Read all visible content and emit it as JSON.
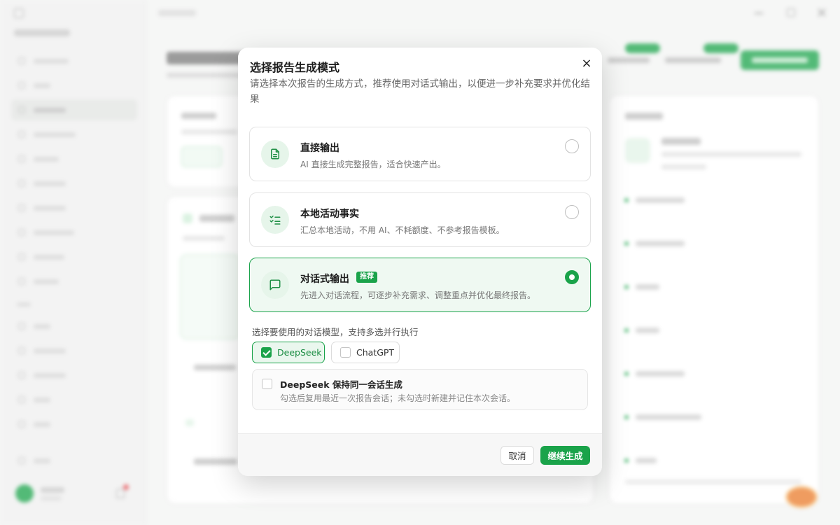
{
  "modal": {
    "title": "选择报告生成模式",
    "description": "请选择本次报告的生成方式，推荐使用对话式输出，以便进一步补充要求并优化结果",
    "close_icon": "×",
    "options": [
      {
        "title": "直接输出",
        "desc": "AI 直接生成完整报告，适合快速产出。",
        "icon": "document-icon",
        "selected": false
      },
      {
        "title": "本地活动事实",
        "desc": "汇总本地活动，不用 AI、不耗额度、不参考报告模板。",
        "icon": "checklist-icon",
        "selected": false
      },
      {
        "title": "对话式输出",
        "badge": "推荐",
        "desc": "先进入对话流程，可逐步补充需求、调整重点并优化最终报告。",
        "icon": "chat-bubble-icon",
        "selected": true
      }
    ],
    "model_label": "选择要使用的对话模型，支持多选并行执行",
    "models": [
      {
        "label": "DeepSeek",
        "checked": true
      },
      {
        "label": "ChatGPT",
        "checked": false
      }
    ],
    "keep_session": {
      "title": "DeepSeek 保持同一会话生成",
      "desc": "勾选后复用最近一次报告会话；未勾选时新建并记住本次会话。",
      "checked": false
    },
    "cancel_label": "取消",
    "continue_label": "继续生成"
  },
  "colors": {
    "accent": "#1aa34a",
    "accent_bg": "#eff9f2"
  }
}
